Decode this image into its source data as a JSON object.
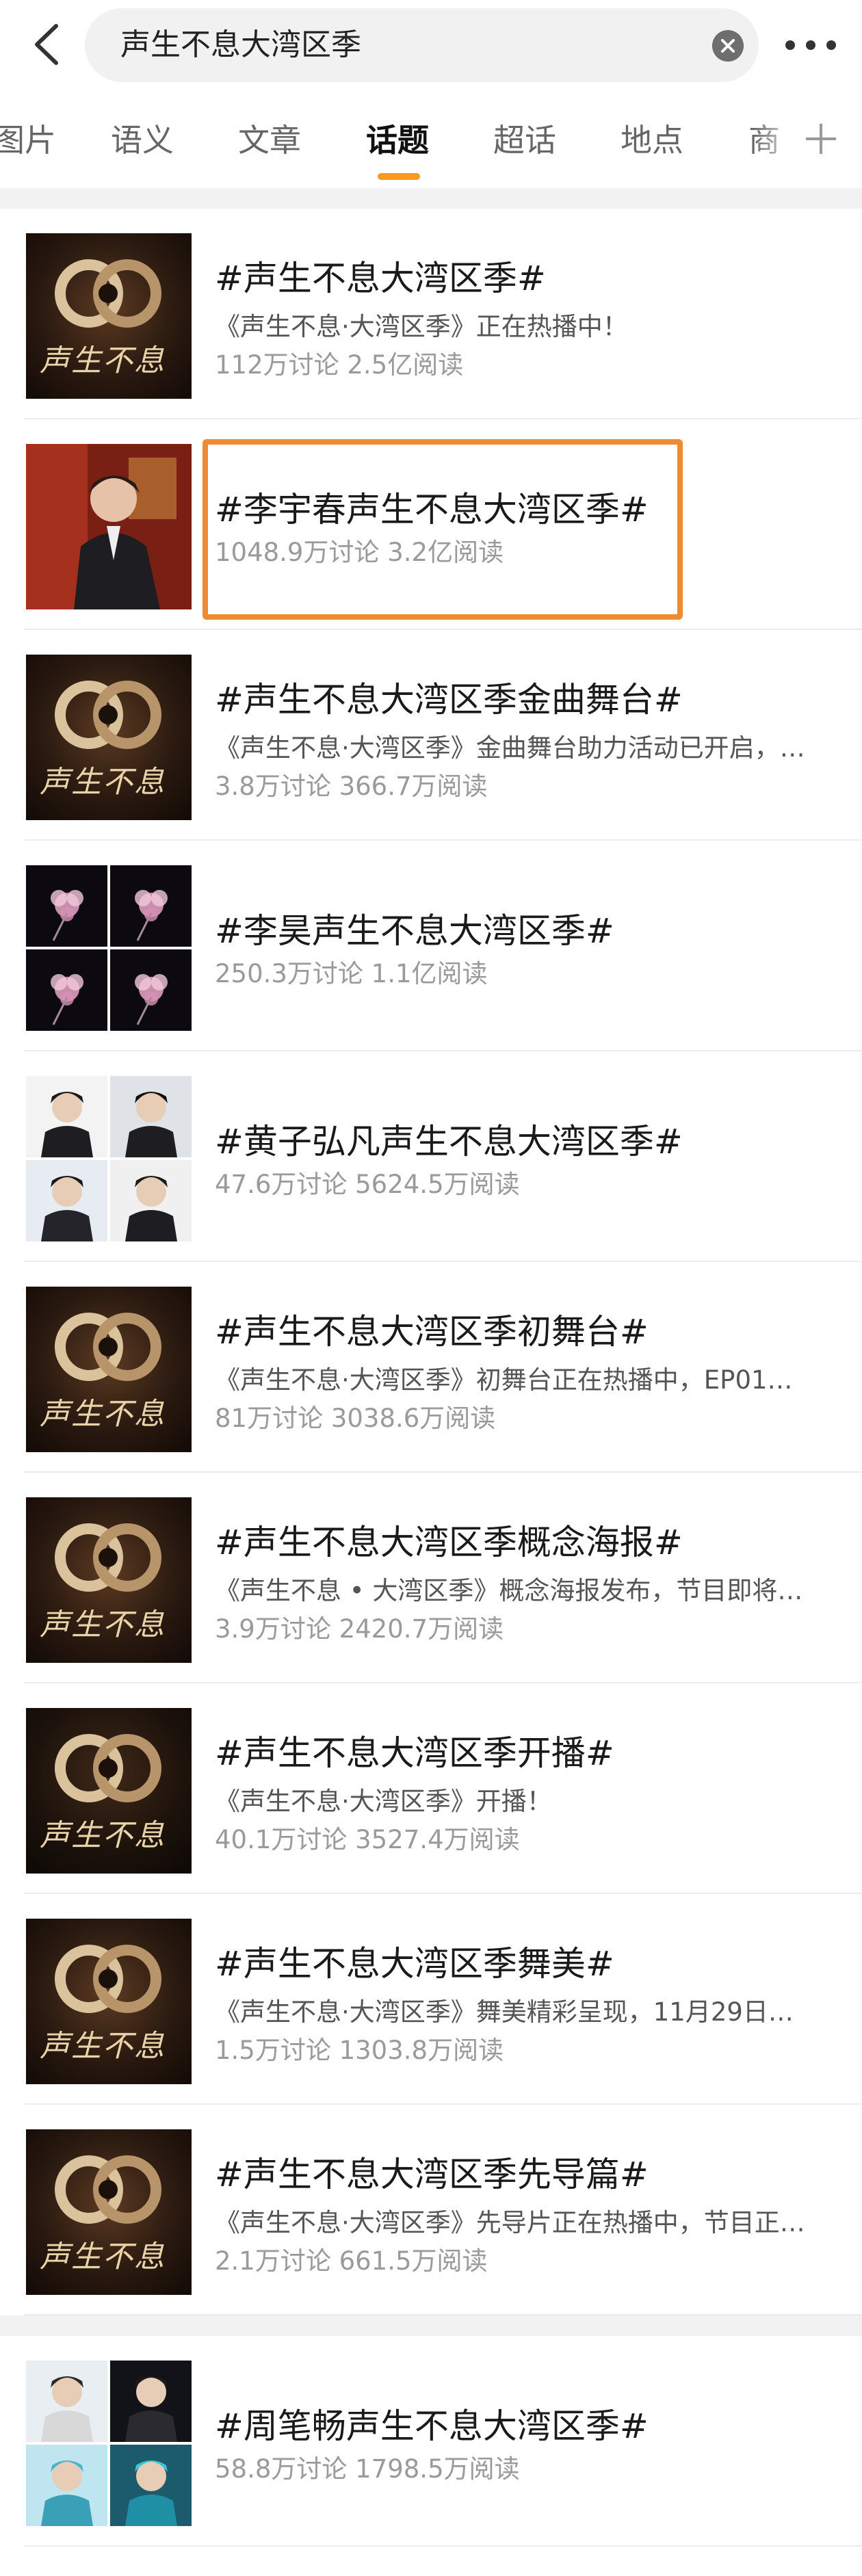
{
  "header": {
    "query": "声生不息大湾区季"
  },
  "tabs": [
    {
      "label": "图片",
      "active": false
    },
    {
      "label": "语义",
      "active": false
    },
    {
      "label": "文章",
      "active": false
    },
    {
      "label": "话题",
      "active": true
    },
    {
      "label": "超话",
      "active": false
    },
    {
      "label": "地点",
      "active": false
    },
    {
      "label": "商",
      "active": false
    }
  ],
  "logo_text": "声生不息",
  "topics": [
    {
      "title": "#声生不息大湾区季#",
      "desc": "《声生不息·大湾区季》正在热播中！",
      "stats": "112万讨论 2.5亿阅读",
      "thumb": "logo"
    },
    {
      "title": "#李宇春声生不息大湾区季#",
      "desc": "",
      "stats": "1048.9万讨论 3.2亿阅读",
      "thumb": "photo-red",
      "highlighted": true
    },
    {
      "title": "#声生不息大湾区季金曲舞台#",
      "desc": "《声生不息·大湾区季》金曲舞台助力活动已开启，…",
      "stats": "3.8万讨论 366.7万阅读",
      "thumb": "logo"
    },
    {
      "title": "#李昊声生不息大湾区季#",
      "desc": "",
      "stats": "250.3万讨论 1.1亿阅读",
      "thumb": "flowers"
    },
    {
      "title": "#黄子弘凡声生不息大湾区季#",
      "desc": "",
      "stats": "47.6万讨论 5624.5万阅读",
      "thumb": "portraits"
    },
    {
      "title": "#声生不息大湾区季初舞台#",
      "desc": "《声生不息·大湾区季》初舞台正在热播中，EP01…",
      "stats": "81万讨论 3038.6万阅读",
      "thumb": "logo"
    },
    {
      "title": "#声生不息大湾区季概念海报#",
      "desc": "《声生不息 • 大湾区季》概念海报发布，节目即将…",
      "stats": "3.9万讨论 2420.7万阅读",
      "thumb": "logo"
    },
    {
      "title": "#声生不息大湾区季开播#",
      "desc": "《声生不息·大湾区季》开播！",
      "stats": "40.1万讨论 3527.4万阅读",
      "thumb": "logo-dark"
    },
    {
      "title": "#声生不息大湾区季舞美#",
      "desc": "《声生不息·大湾区季》舞美精彩呈现，11月29日…",
      "stats": "1.5万讨论 1303.8万阅读",
      "thumb": "logo"
    },
    {
      "title": "#声生不息大湾区季先导篇#",
      "desc": "《声生不息·大湾区季》先导片正在热播中，节目正…",
      "stats": "2.1万讨论 661.5万阅读",
      "thumb": "logo"
    },
    {
      "title": "#周笔畅声生不息大湾区季#",
      "desc": "",
      "stats": "58.8万讨论 1798.5万阅读",
      "thumb": "portraits-blue"
    }
  ],
  "colors": {
    "accent": "#ff9a1e",
    "highlight_border": "#ee8b34",
    "section_gap": "#f2f2f2"
  },
  "icons": [
    "back-arrow-icon",
    "clear-icon",
    "more-icon",
    "plus-icon"
  ]
}
